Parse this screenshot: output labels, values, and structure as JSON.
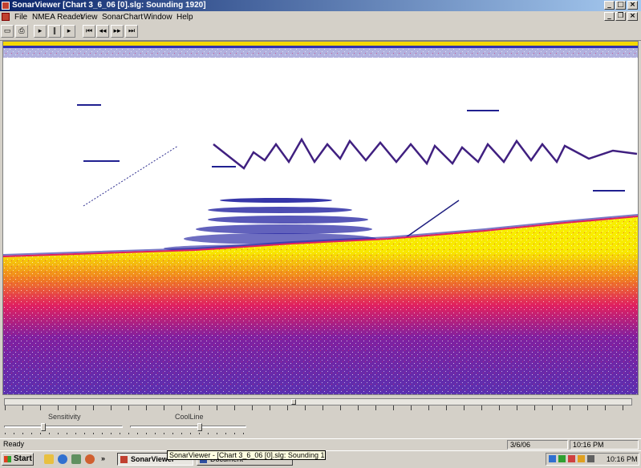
{
  "window": {
    "app_name": "SonarViewer",
    "title": "SonarViewer   [Chart 3_6_06 [0].slg: Sounding 1920]"
  },
  "menu": {
    "items": [
      "File",
      "NMEA Reader",
      "View",
      "SonarChart",
      "Window",
      "Help"
    ]
  },
  "toolbar": {
    "icons": [
      "open-icon",
      "print-icon",
      "play-icon",
      "pause-icon",
      "step-forward-icon",
      "skip-start-icon",
      "rewind-icon",
      "fast-forward-icon",
      "skip-end-icon"
    ]
  },
  "controls": {
    "sensitivity_label": "Sensitivity",
    "sensitivity_value": 0.33,
    "coolline_label": "CoolLine",
    "coolline_value": 0.6,
    "scroll_position": 0.46
  },
  "status": {
    "text": "Ready",
    "date": "3/6/06",
    "time": "10:16 PM"
  },
  "taskbar": {
    "start_label": "Start",
    "task_label": "SonarViewer",
    "task_label_2": "Document",
    "tooltip": "SonarViewer - [Chart 3_6_06 [0].slg: Sounding 1920]",
    "clock": "10:16 PM",
    "chevron": "»"
  },
  "colors": {
    "surface_band": "#f5d800",
    "bottom_yellow": "#f8f000",
    "bottom_red": "#e02060",
    "bottom_purple": "#5a20a0",
    "clutter_blue": "#2020a0"
  }
}
